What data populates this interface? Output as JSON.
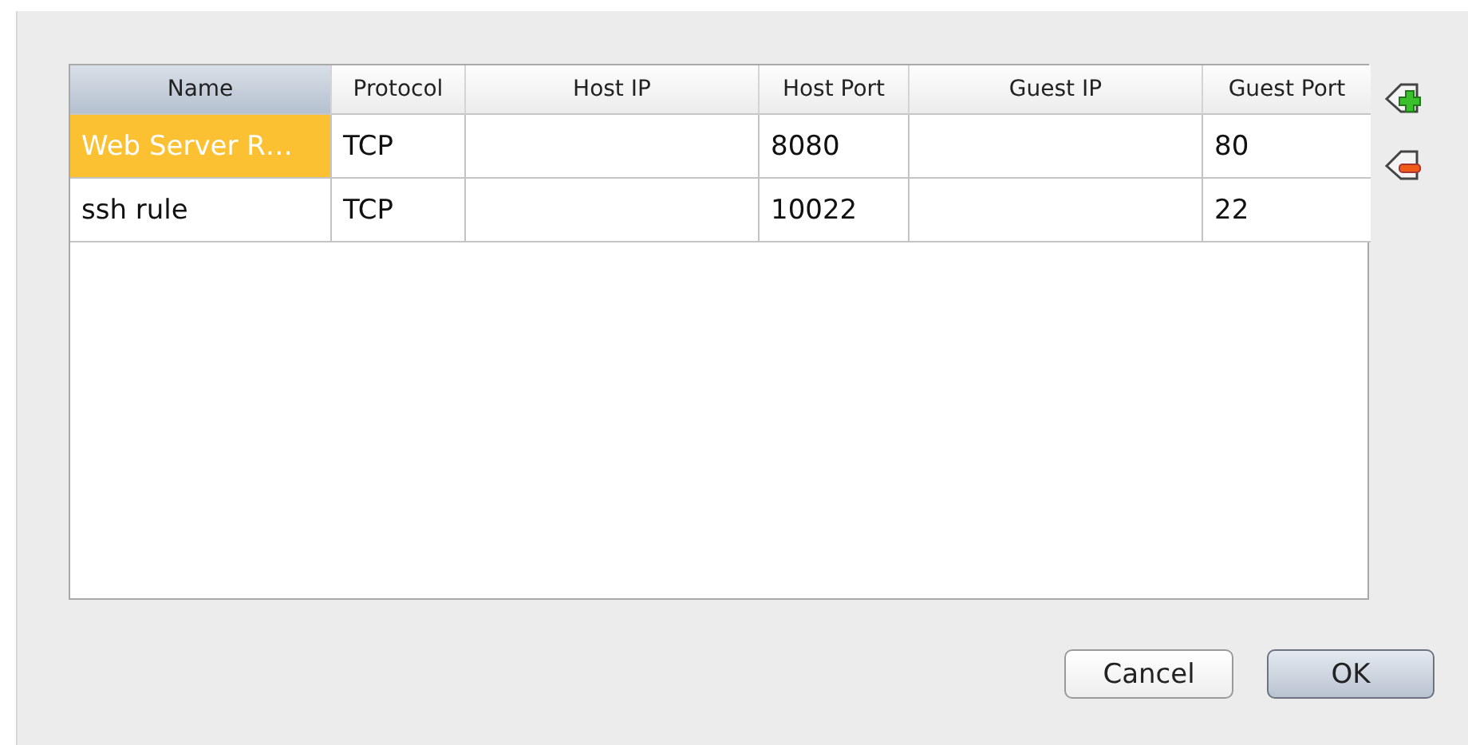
{
  "table": {
    "columns": [
      {
        "label": "Name",
        "sorted": true
      },
      {
        "label": "Protocol",
        "sorted": false
      },
      {
        "label": "Host IP",
        "sorted": false
      },
      {
        "label": "Host Port",
        "sorted": false
      },
      {
        "label": "Guest IP",
        "sorted": false
      },
      {
        "label": "Guest Port",
        "sorted": false
      }
    ],
    "rows": [
      {
        "selected": true,
        "cells": [
          "Web Server R…",
          "TCP",
          "",
          "8080",
          "",
          "80"
        ]
      },
      {
        "selected": false,
        "cells": [
          "ssh rule",
          "TCP",
          "",
          "10022",
          "",
          "22"
        ]
      }
    ]
  },
  "buttons": [
    {
      "label": "Cancel",
      "default": false
    },
    {
      "label": "OK",
      "default": true
    }
  ]
}
